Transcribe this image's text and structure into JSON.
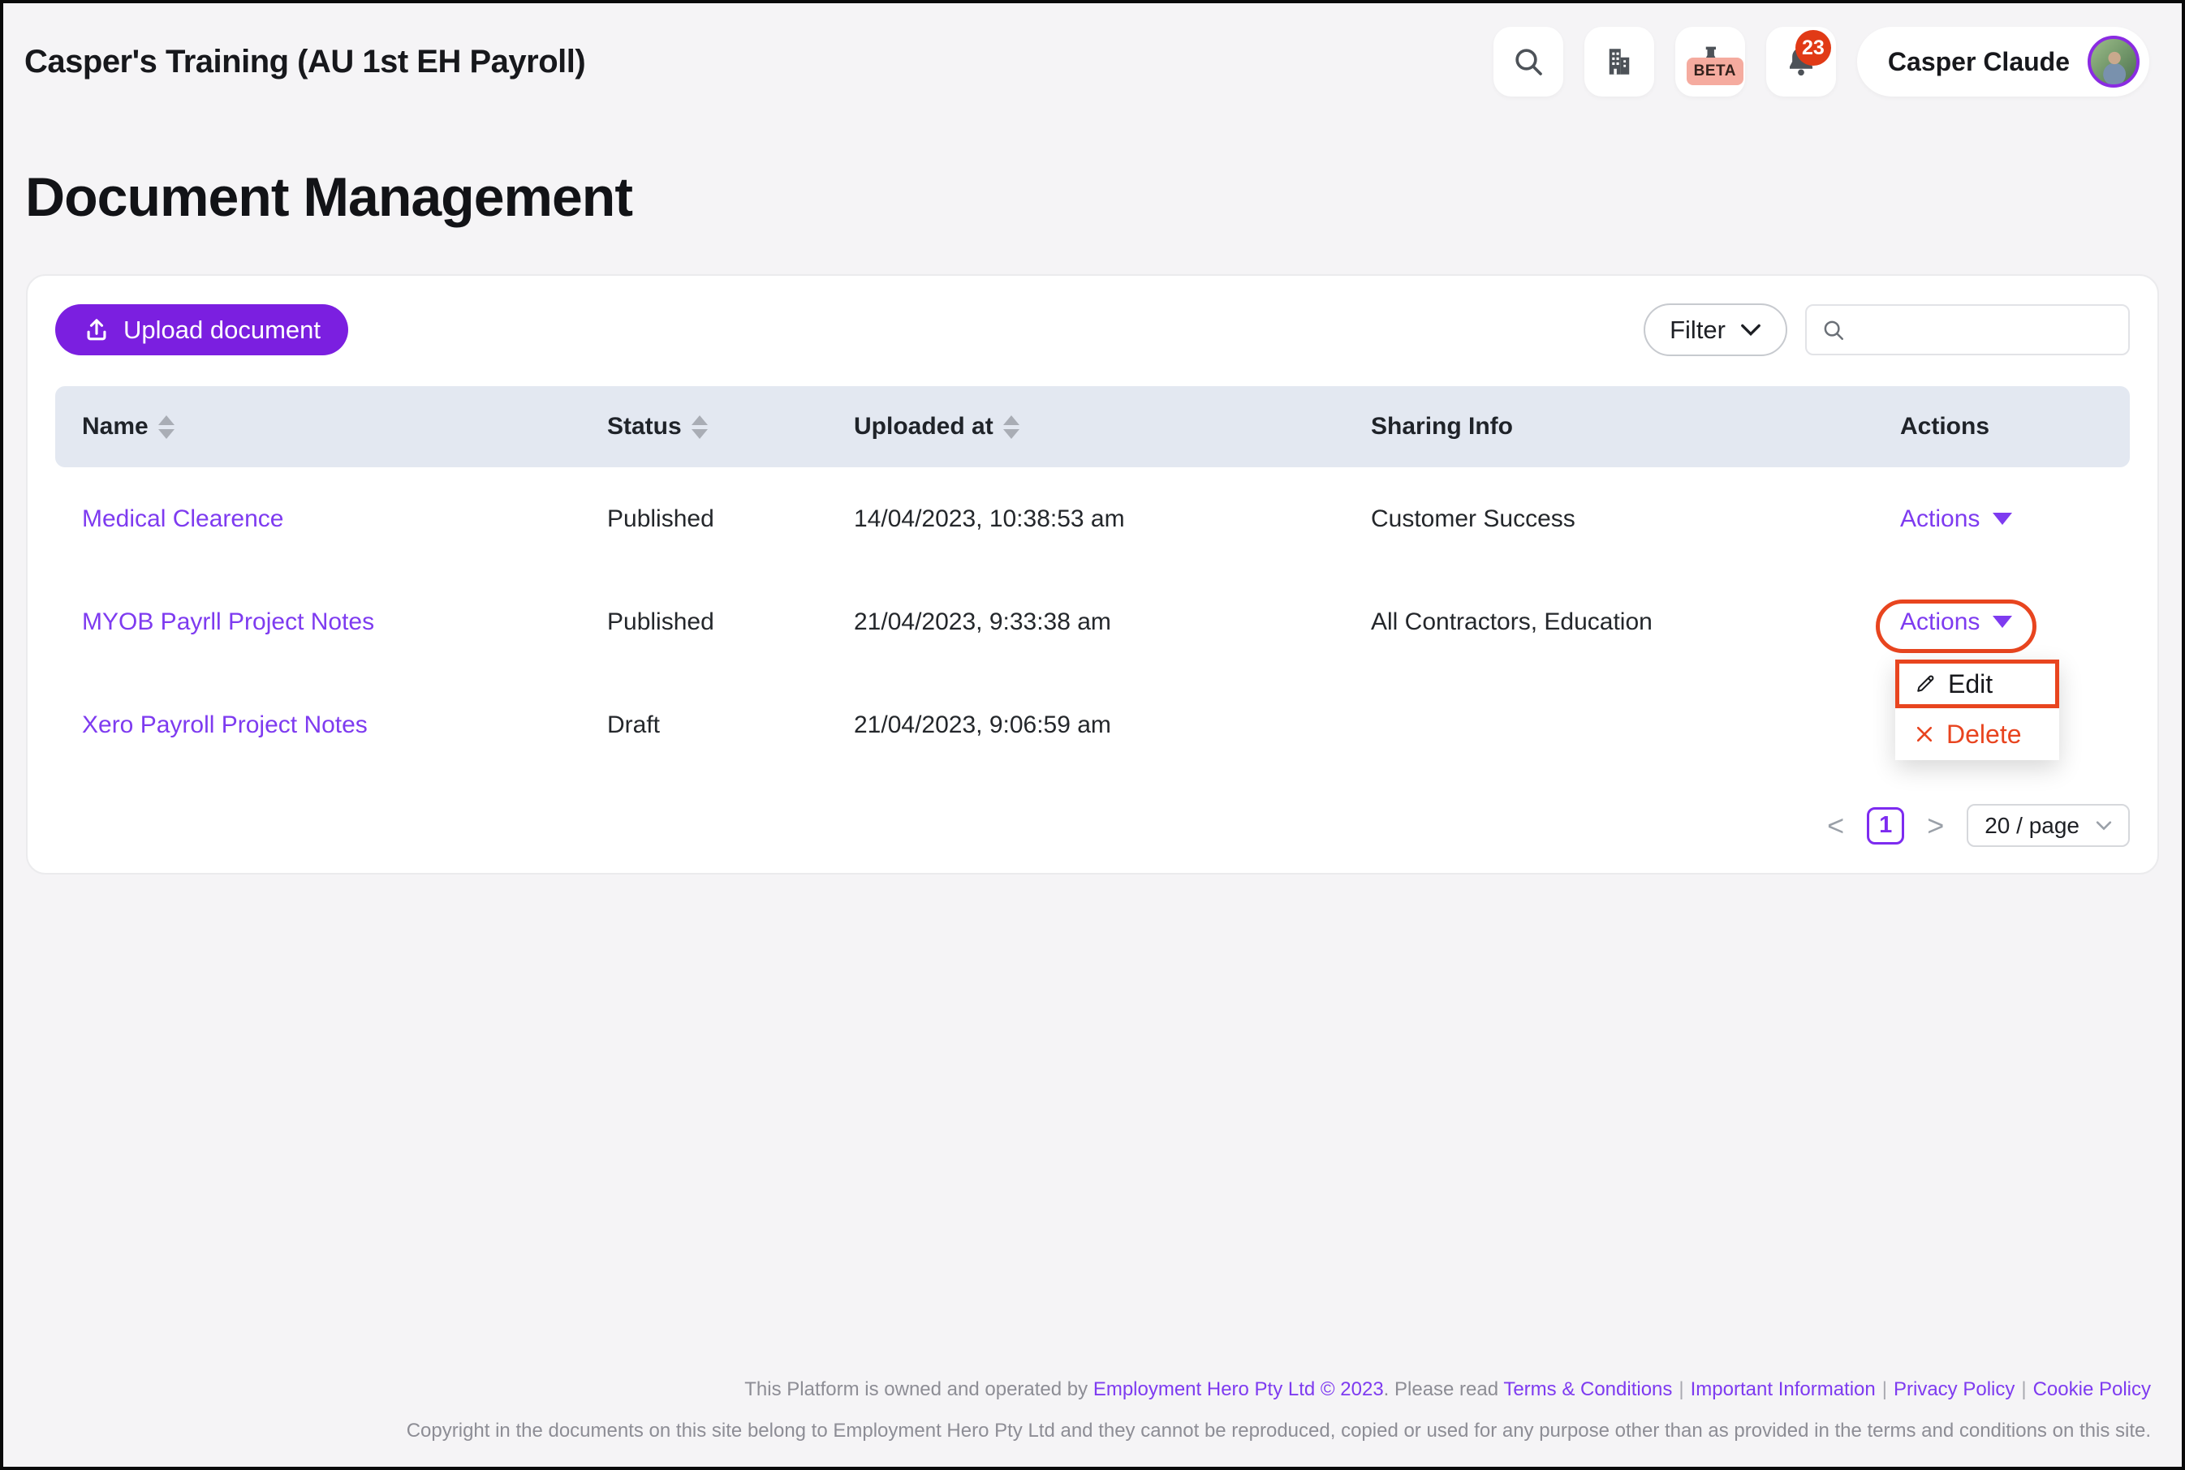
{
  "topbar": {
    "title": "Casper's Training (AU 1st EH Payroll)",
    "icons": [
      {
        "name": "search"
      },
      {
        "name": "organisation"
      },
      {
        "name": "beta-flask",
        "badge": "BETA"
      },
      {
        "name": "notifications",
        "badge": "23"
      }
    ],
    "user": {
      "name": "Casper Claude"
    }
  },
  "page": {
    "title": "Document Management"
  },
  "toolbar": {
    "upload_label": "Upload document",
    "filter_label": "Filter",
    "search_placeholder": ""
  },
  "table": {
    "columns": [
      {
        "label": "Name",
        "sortable": true
      },
      {
        "label": "Status",
        "sortable": true
      },
      {
        "label": "Uploaded at",
        "sortable": true
      },
      {
        "label": "Sharing Info",
        "sortable": false
      },
      {
        "label": "Actions",
        "sortable": false
      }
    ],
    "rows": [
      {
        "name": "Medical Clearence",
        "status": "Published",
        "uploaded_at": "14/04/2023, 10:38:53 am",
        "sharing": "Customer Success",
        "actions": "Actions"
      },
      {
        "name": "MYOB Payrll Project Notes",
        "status": "Published",
        "uploaded_at": "21/04/2023, 9:33:38 am",
        "sharing": "All Contractors, Education",
        "actions": "Actions"
      },
      {
        "name": "Xero Payroll Project Notes",
        "status": "Draft",
        "uploaded_at": "21/04/2023, 9:06:59 am",
        "sharing": "",
        "actions": ""
      }
    ]
  },
  "menu": {
    "edit_label": "Edit",
    "delete_label": "Delete"
  },
  "pagination": {
    "prev": "<",
    "next": ">",
    "current": "1",
    "page_size": "20 / page"
  },
  "footer": {
    "line1_prefix": "This Platform is owned and operated by ",
    "company_link": "Employment Hero Pty Ltd © 2023",
    "line1_mid": ". Please read ",
    "links": [
      "Terms & Conditions",
      "Important Information",
      "Privacy Policy",
      "Cookie Policy"
    ],
    "separator": "|",
    "line2": "Copyright in the documents on this site belong to Employment Hero Pty Ltd and they cannot be reproduced, copied or used for any purpose other than as provided in the terms and conditions on this site."
  },
  "colors": {
    "brand_purple": "#7b1fe0",
    "link_purple": "#7e3bf0",
    "annotation_orange": "#e8451f",
    "delete_red": "#e8441f",
    "table_header_bg": "#e3e8f1",
    "notification_badge": "#e13a16",
    "beta_badge_bg": "#f5ab9f"
  }
}
